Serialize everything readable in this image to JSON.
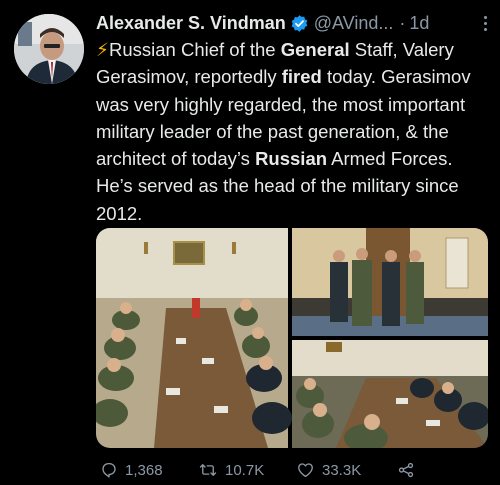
{
  "author": {
    "name": "Alexander S. Vindman",
    "handle": "@AVind...",
    "separator": "·",
    "time": "1d"
  },
  "tweet": {
    "emoji": "⚡",
    "t1": "Russian Chief of the ",
    "b1": "General",
    "t2": " Staff, Valery Gerasimov, reportedly ",
    "b2": "fired",
    "t3": " today. Gerasimov was very highly regarded, the most important military leader of the past generation, & the architect of today’s ",
    "b3": "Russian",
    "t4": " Armed Forces. He’s served as the head of the military since 2012."
  },
  "media": {
    "photo_count": 3,
    "icons": [
      "meeting-photo",
      "generals-photo",
      "conference-photo"
    ]
  },
  "actions": {
    "replies": "1,368",
    "retweets": "10.7K",
    "likes": "33.3K"
  },
  "colors": {
    "background": "#000000",
    "text": "#e7e9ea",
    "muted": "#8b98a5",
    "verified": "#1d9bf0"
  },
  "icons": [
    "verified-badge-icon",
    "more-icon",
    "reply-icon",
    "retweet-icon",
    "like-icon",
    "share-icon"
  ]
}
